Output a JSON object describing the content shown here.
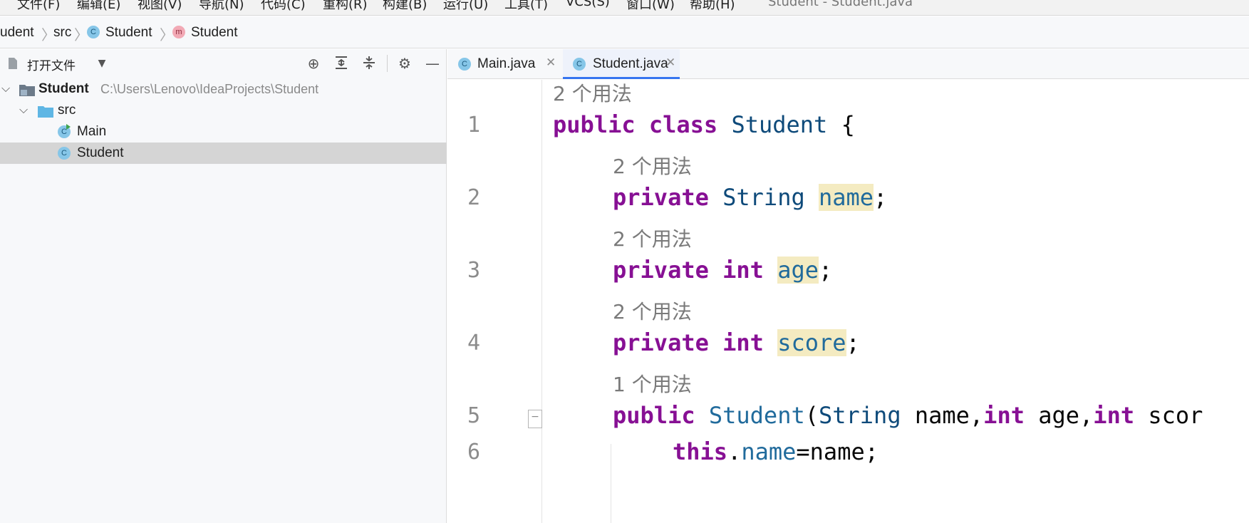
{
  "menu": {
    "items": [
      "文件(F)",
      "编辑(E)",
      "视图(V)",
      "导航(N)",
      "代码(C)",
      "重构(R)",
      "构建(B)",
      "运行(U)",
      "工具(T)",
      "VCS(S)",
      "窗口(W)",
      "帮助(H)"
    ],
    "window_title": "Student - Student.java"
  },
  "breadcrumb": {
    "project": "udent",
    "folder": "src",
    "class": "Student",
    "method": "Student",
    "class_badge": "C",
    "method_badge": "m"
  },
  "project_panel": {
    "title": "打开文件",
    "icons": [
      "locate-icon",
      "expand-all-icon",
      "collapse-all-icon",
      "gear-icon",
      "minimize-icon"
    ],
    "tree": {
      "root_name": "Student",
      "root_path": "C:\\Users\\Lenovo\\IdeaProjects\\Student",
      "src_label": "src",
      "main_label": "Main",
      "student_label": "Student"
    }
  },
  "tabs": [
    {
      "label": "Main.java",
      "badge": "C",
      "active": false
    },
    {
      "label": "Student.java",
      "badge": "C",
      "active": true
    }
  ],
  "editor": {
    "hint_class": "2 个用法",
    "hint_name": "2 个用法",
    "hint_age": "2 个用法",
    "hint_score": "2 个用法",
    "hint_ctor": "1 个用法",
    "line_numbers": [
      "1",
      "2",
      "3",
      "4",
      "5",
      "6"
    ],
    "line1": {
      "kw1": "public",
      "kw2": "class",
      "type": "Student",
      "rest": "{"
    },
    "line2": {
      "kw": "private",
      "type": "String",
      "field": "name",
      "rest": ";"
    },
    "line3": {
      "kw": "private",
      "type": "int",
      "field": "age",
      "rest": ";"
    },
    "line4": {
      "kw": "private",
      "type": "int",
      "field": "score",
      "rest": ";"
    },
    "line5": {
      "kw": "public",
      "name": "Student",
      "p1type": "String",
      "p1": " name,",
      "p2type": "int",
      "p2": " age,",
      "p3type": "int",
      "p3": " scor"
    },
    "line6": {
      "kw": "this",
      "dot": ".",
      "field": "name",
      "rest": "=name;"
    },
    "colors": {
      "keyword": "#871094",
      "type": "#0e4a7a",
      "field": "#216b9c",
      "highlight": "#f4ebc1",
      "tab_accent": "#3574f0"
    }
  }
}
